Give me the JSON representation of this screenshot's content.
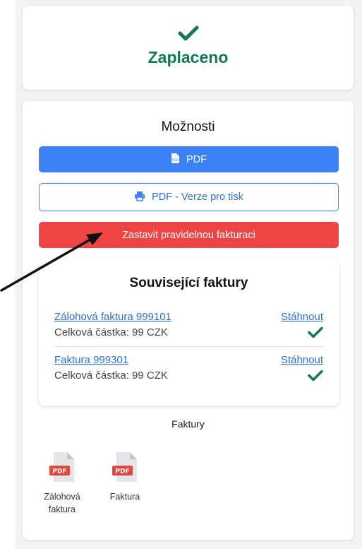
{
  "status": {
    "icon": "check-icon",
    "label": "Zaplaceno",
    "color": "#127a52"
  },
  "options": {
    "title": "Možnosti",
    "buttons": {
      "pdf": {
        "label": "PDF",
        "icon": "file-pdf-icon",
        "color": "#3c82f6"
      },
      "print": {
        "label": "PDF - Verze pro tisk",
        "icon": "printer-icon",
        "color": "#3c82f6"
      },
      "stop": {
        "label": "Zastavit pravidelnou fakturaci",
        "color": "#ef4444"
      }
    }
  },
  "related": {
    "title": "Související faktury",
    "items": [
      {
        "name": "Zálohová faktura 999101",
        "amount": "Celková částka: 99 CZK",
        "download": "Stáhnout",
        "paid_icon": "check-icon"
      },
      {
        "name": "Faktura 999301",
        "amount": "Celková částka: 99 CZK",
        "download": "Stáhnout",
        "paid_icon": "check-icon"
      }
    ]
  },
  "files": {
    "heading": "Faktury",
    "items": [
      {
        "icon": "pdf-file-icon",
        "badge": "PDF",
        "label_line1": "Zálohová",
        "label_line2": "faktura"
      },
      {
        "icon": "pdf-file-icon",
        "badge": "PDF",
        "label_line1": "Faktura",
        "label_line2": ""
      }
    ]
  },
  "annotation": {
    "icon": "arrow-icon"
  }
}
